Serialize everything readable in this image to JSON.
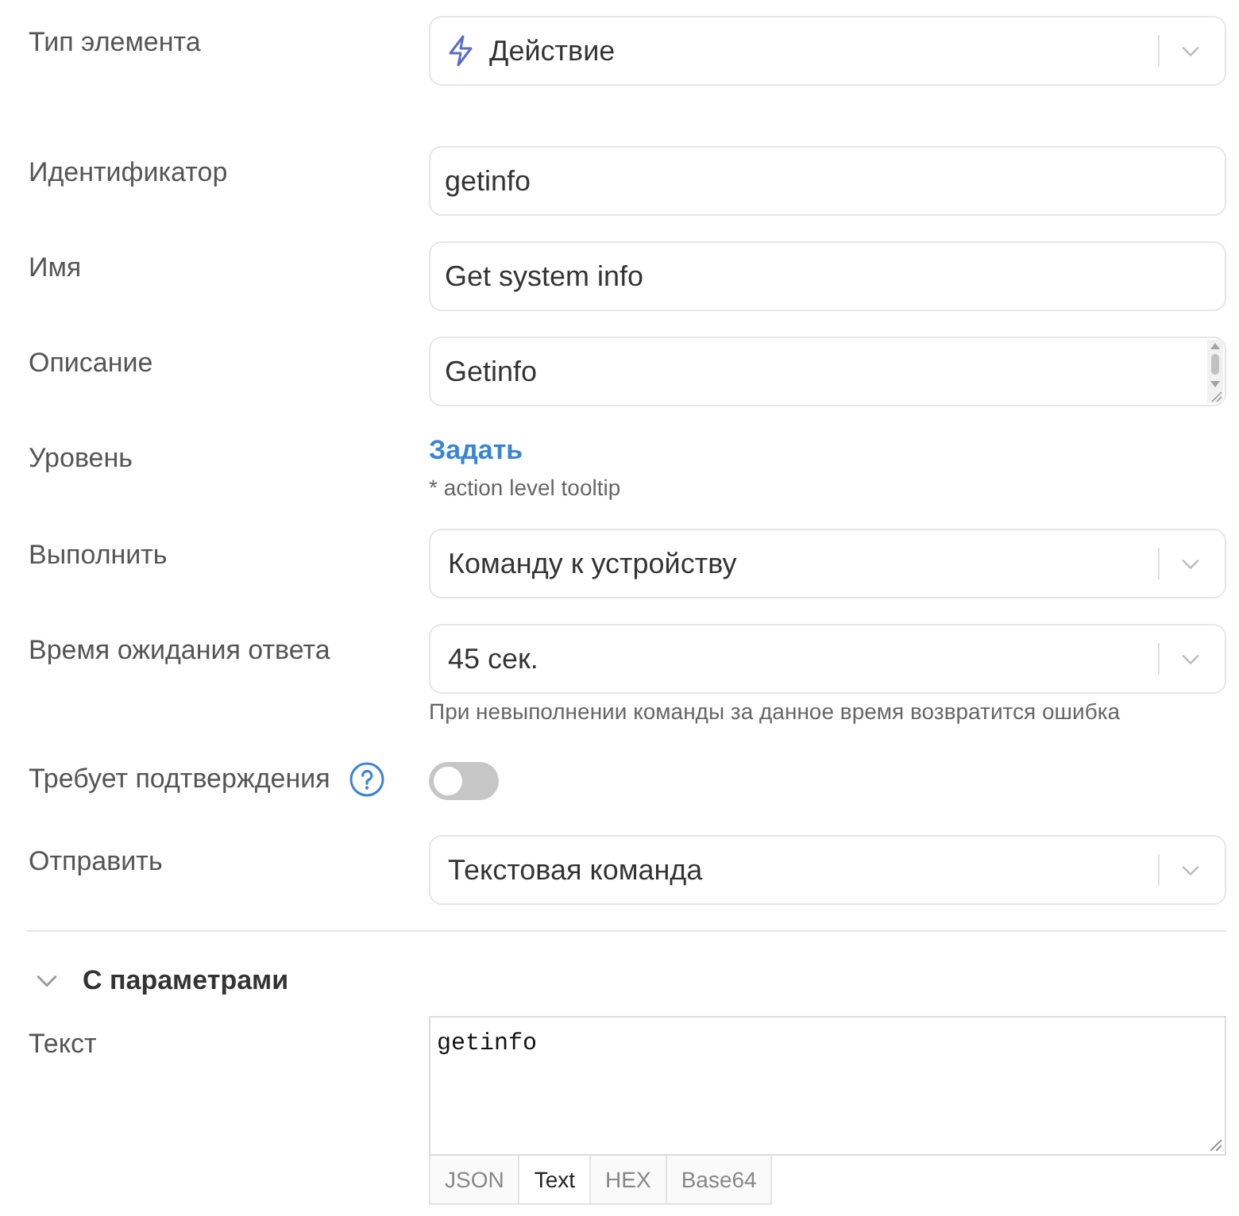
{
  "fields": [
    {
      "kind": "select",
      "label": "Тип элемента",
      "value": "Действие",
      "has_icon": true
    },
    {
      "kind": "input",
      "label": "Идентификатор",
      "value": "getinfo"
    },
    {
      "kind": "input",
      "label": "Имя",
      "value": "Get system info"
    },
    {
      "kind": "textarea",
      "label": "Описание",
      "value": "Getinfo"
    },
    {
      "kind": "link",
      "label": "Уровень",
      "link": "Задать",
      "hint": "* action level tooltip"
    },
    {
      "kind": "select",
      "label": "Выполнить",
      "value": "Команду к устройству"
    },
    {
      "kind": "select",
      "label": "Время ожидания ответа",
      "value": "45 сек.",
      "hint": "При невыполнении команды за данное время возвратится ошибка"
    },
    {
      "kind": "toggle",
      "label": "Требует подтверждения",
      "help": true,
      "on": false
    },
    {
      "kind": "select",
      "label": "Отправить",
      "value": "Текстовая команда"
    }
  ],
  "section": {
    "title": "С параметрами",
    "expanded": true,
    "fields": [
      {
        "kind": "code",
        "label": "Текст",
        "value": "getinfo",
        "formats": [
          {
            "label": "JSON",
            "selected": false
          },
          {
            "label": "Text",
            "selected": true
          },
          {
            "label": "HEX",
            "selected": false
          },
          {
            "label": "Base64",
            "selected": false
          }
        ]
      }
    ]
  }
}
